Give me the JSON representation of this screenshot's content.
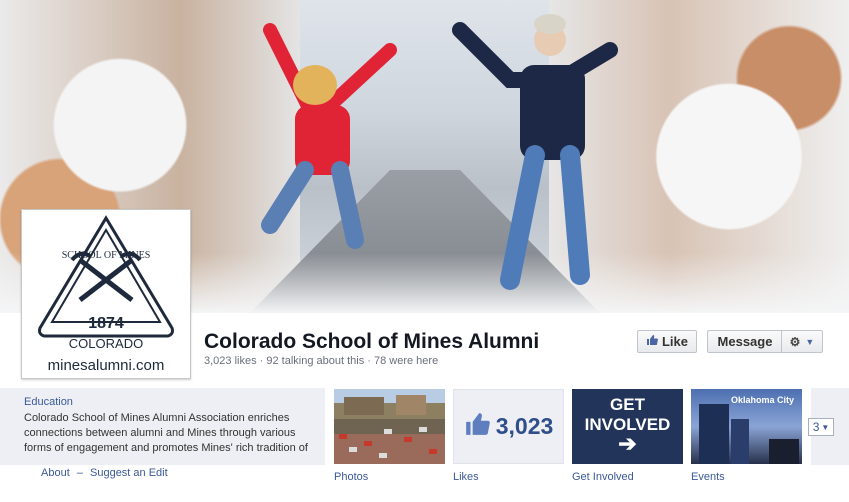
{
  "page": {
    "name": "Colorado School of Mines Alumni",
    "stats": "3,023 likes · 92 talking about this · 78 were here",
    "profile": {
      "seal_top": "SCHOOL OF MINES",
      "seal_year": "1874",
      "seal_bottom": "COLORADO",
      "url": "minesalumni.com"
    }
  },
  "actions": {
    "like_label": "Like",
    "message_label": "Message"
  },
  "about": {
    "title": "Education",
    "text": "Colorado School of Mines Alumni Association enriches connections between alumni and Mines through various forms of engagement and promotes Mines' rich tradition of",
    "about_link": "About",
    "separator": "–",
    "suggest_link": "Suggest an Edit"
  },
  "apps": [
    {
      "label": "Photos"
    },
    {
      "label": "Likes",
      "count": "3,023"
    },
    {
      "label": "Get Involved",
      "tile_line1": "GET",
      "tile_line2": "INVOLVED"
    },
    {
      "label": "Events",
      "tile_text": "Oklahoma City"
    }
  ],
  "more_count": "3",
  "colors": {
    "link": "#3b5998",
    "accent": "#2f4e8a"
  }
}
